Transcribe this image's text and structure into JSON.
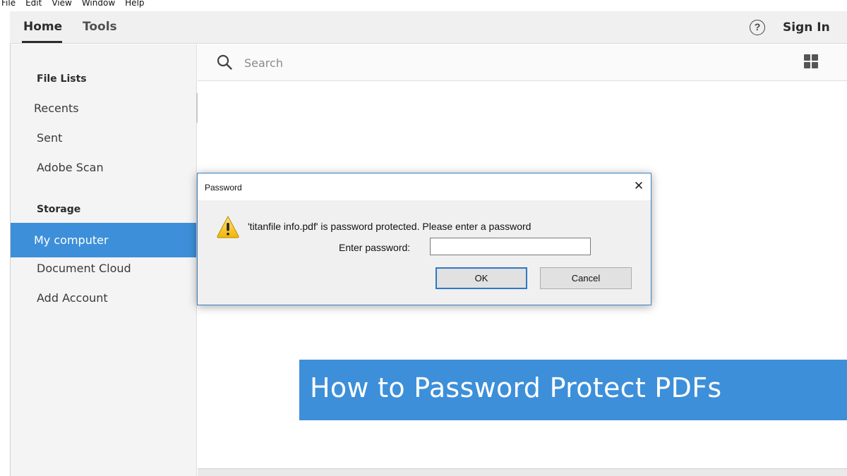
{
  "menubar": {
    "items": [
      "File",
      "Edit",
      "View",
      "Window",
      "Help"
    ]
  },
  "topnav": {
    "tabs": [
      {
        "label": "Home",
        "active": true
      },
      {
        "label": "Tools",
        "active": false
      }
    ],
    "help_icon": "question-circle-icon",
    "help_glyph": "?",
    "sign_in_label": "Sign In"
  },
  "sidebar": {
    "file_lists_heading": "File Lists",
    "file_lists": [
      {
        "label": "Recents"
      },
      {
        "label": "Sent"
      },
      {
        "label": "Adobe Scan"
      }
    ],
    "storage_heading": "Storage",
    "storage": [
      {
        "label": "My computer",
        "active": true
      },
      {
        "label": "Document Cloud"
      },
      {
        "label": "Add Account"
      }
    ]
  },
  "search": {
    "placeholder": "Search",
    "value": "",
    "icon": "search-icon",
    "view_toggle_icon": "grid-view-icon"
  },
  "dialog": {
    "title": "Password",
    "close_glyph": "✕",
    "warning_icon": "warning-triangle-icon",
    "message": "'titanfile info.pdf' is password protected. Please enter a password",
    "password_label": "Enter password:",
    "password_value": "",
    "ok_label": "OK",
    "cancel_label": "Cancel"
  },
  "banner": {
    "text": "How to Password Protect PDFs"
  },
  "colors": {
    "accent": "#3d8fd9",
    "sidebar_bg": "#f4f4f4",
    "dialog_bg": "#f0f0f0",
    "dialog_border": "#3b82c4"
  }
}
